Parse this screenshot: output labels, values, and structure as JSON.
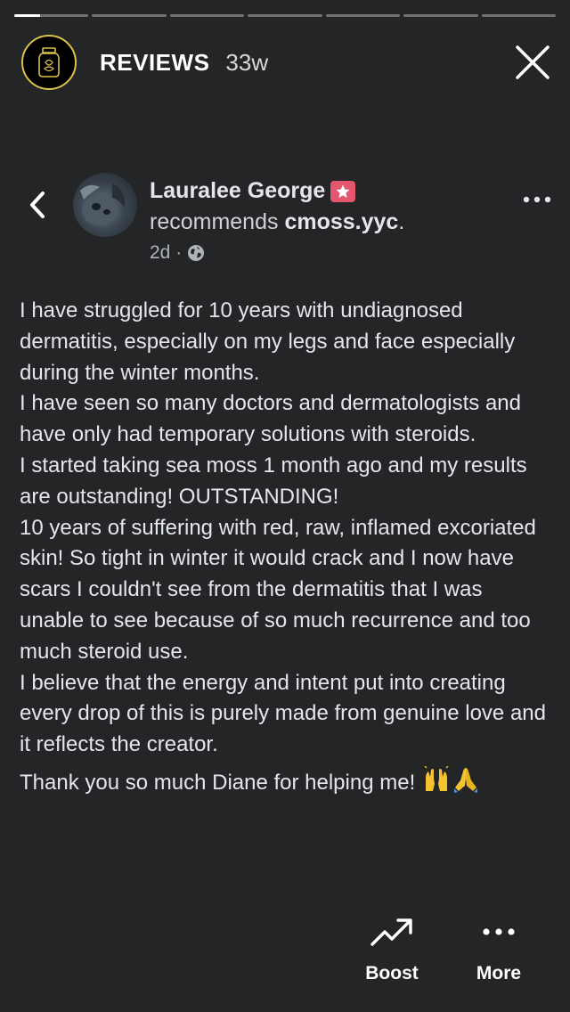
{
  "progress": {
    "segment_count": 7,
    "segments": [
      {
        "fill": 0.35
      },
      {
        "fill": 0
      },
      {
        "fill": 0
      },
      {
        "fill": 0
      },
      {
        "fill": 0
      },
      {
        "fill": 0
      },
      {
        "fill": 0
      }
    ]
  },
  "story": {
    "title": "REVIEWS",
    "age": "33w",
    "avatar_ring_color": "#d9c24a",
    "close_icon": "close-icon"
  },
  "post": {
    "author": "Lauralee George",
    "recommends_prefix": "recommends ",
    "page_name": "cmoss.yyc",
    "recommends_suffix": ".",
    "time": "2d",
    "time_separator": " · ",
    "audience_icon": "globe-icon",
    "badge_color": "#e4566e",
    "paragraphs": [
      "I have struggled for 10 years with undiagnosed dermatitis, especially on my legs and face especially during the winter months.",
      "I have seen so many doctors and dermatologists and have only had temporary solutions with steroids.",
      "I started taking sea moss 1 month ago and my results are outstanding! OUTSTANDING!",
      "10 years of suffering with red, raw, inflamed excoriated skin! So tight in winter it would crack and I now have scars I couldn't see from the dermatitis that I was unable to see because of so much recurrence and too much steroid use.",
      "I believe that the energy and intent put into creating every drop of this is purely made from genuine love and it reflects the creator."
    ],
    "thanks": "Thank you so much Diane for helping me! ",
    "emojis": [
      "raising-hands-emoji",
      "folded-hands-emoji"
    ]
  },
  "actions": {
    "boost_label": "Boost",
    "more_label": "More"
  }
}
